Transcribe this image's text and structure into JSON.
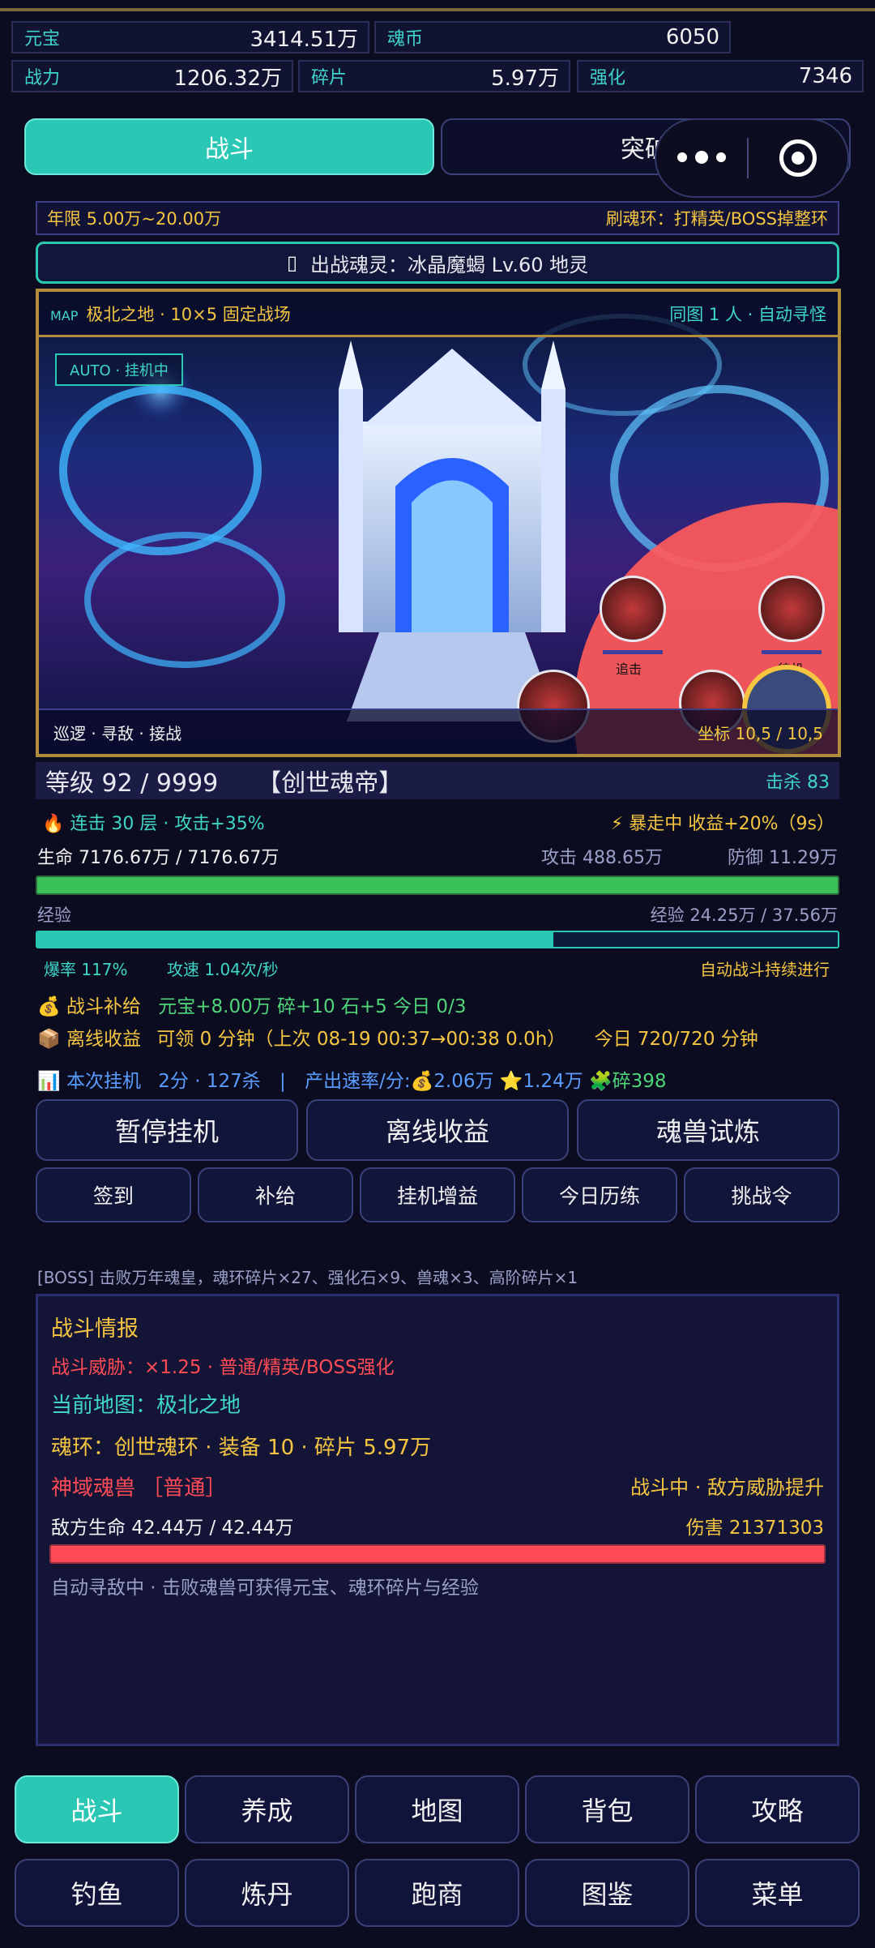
{
  "stats": [
    {
      "label": "元宝",
      "value": "3414.51万"
    },
    {
      "label": "魂币",
      "value": "6050"
    },
    {
      "label": "战力",
      "value": "1206.32万"
    },
    {
      "label": "碎片",
      "value": "5.97万"
    },
    {
      "label": "强化",
      "value": "7346"
    }
  ],
  "tabs": {
    "battle": "战斗",
    "breakthrough": "突破"
  },
  "info_bar": {
    "year_range": "年限 5.00万~20.00万",
    "hint": "刷魂环：打精英/BOSS掉整环"
  },
  "spirit_banner": {
    "icon": "sparkle-icon",
    "text": "出战魂灵：冰晶魔蝎 Lv.60 地灵"
  },
  "map": {
    "tag": "MAP",
    "name": "极北之地 · 10×5 固定战场",
    "same_map": "同图 1 人 · 自动寻怪",
    "auto_badge": "AUTO · 挂机中",
    "actions": "巡逻 · 寻敌 · 接战",
    "coords": "坐标 10,5 / 10,5",
    "monster_labels": [
      "追击",
      "待机"
    ]
  },
  "level": {
    "text": "等级 92 / 9999",
    "title": "【创世魂帝】",
    "kills": "击杀 83"
  },
  "combo": {
    "text": "连击 30 层 · 攻击+35%",
    "rush": "暴走中 收益+20%（9s）"
  },
  "life": {
    "text": "生命 7176.67万 / 7176.67万",
    "attack": "攻击 488.65万",
    "defense": "防御 11.29万",
    "fill": 1.0
  },
  "exp": {
    "label": "经验",
    "text": "经验 24.25万 / 37.56万",
    "fill": 0.645
  },
  "rates": {
    "crit": "爆率 117%",
    "speed": "攻速 1.04次/秒",
    "auto": "自动战斗持续进行"
  },
  "supply": {
    "icon": "money-bag-icon",
    "label": "战斗补给",
    "detail": "元宝+8.00万 碎+10 石+5 今日 0/3"
  },
  "offline": {
    "icon": "box-icon",
    "label": "离线收益",
    "detail": "可领 0 分钟（上次 08-19 00:37→00:38 0.0h）",
    "today": "今日 720/720 分钟"
  },
  "session": {
    "icon": "chart-icon",
    "label": "本次挂机",
    "detail": "2分 · 127杀",
    "sep": "|",
    "rate": "产出速率/分:",
    "r1": "💰2.06万",
    "r2": "⭐1.24万",
    "r3": "🧩碎398"
  },
  "big_buttons": [
    "暂停挂机",
    "离线收益",
    "魂兽试炼"
  ],
  "small_buttons": [
    "签到",
    "补给",
    "挂机增益",
    "今日历练",
    "挑战令"
  ],
  "log": "[BOSS] 击败万年魂皇，魂环碎片×27、强化石×9、兽魂×3、高阶碎片×1",
  "battle": {
    "title": "战斗情报",
    "threat": "战斗威胁：×1.25 · 普通/精英/BOSS强化",
    "current_map": "当前地图：极北之地",
    "ring": "魂环：创世魂环 · 装备 10 · 碎片 5.97万",
    "enemy_name": "神域魂兽 ［普通］",
    "status": "战斗中 · 敌方威胁提升",
    "enemy_hp": "敌方生命 42.44万 / 42.44万",
    "damage": "伤害 21371303",
    "enemy_fill": 1.0,
    "footer": "自动寻敌中 · 击败魂兽可获得元宝、魂环碎片与经验"
  },
  "nav_row1": [
    "战斗",
    "养成",
    "地图",
    "背包",
    "攻略"
  ],
  "nav_row2": [
    "钓鱼",
    "炼丹",
    "跑商",
    "图鉴",
    "菜单"
  ],
  "colors": {
    "teal": "#2ac7b5",
    "red": "#ff4b56",
    "gold": "#f5c542",
    "green": "#3bc15a"
  }
}
